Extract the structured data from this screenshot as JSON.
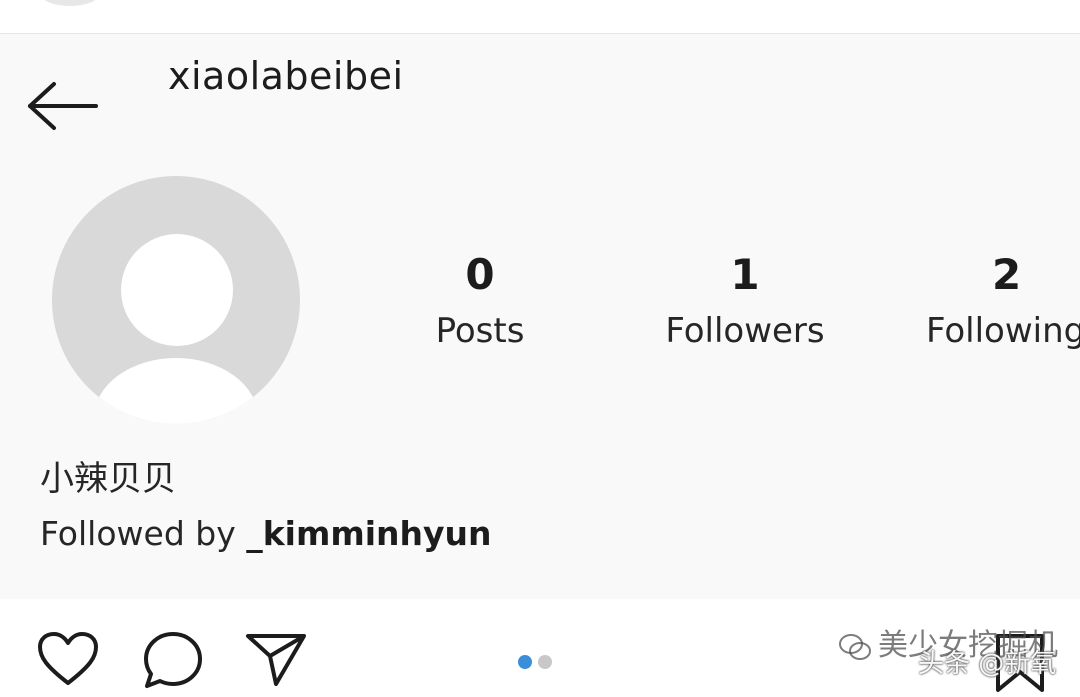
{
  "header": {
    "back_icon": "arrow-left-icon",
    "username": "xiaolabeibei"
  },
  "profile": {
    "avatar_icon": "default-avatar-icon",
    "stats": [
      {
        "value": "0",
        "label": "Posts"
      },
      {
        "value": "1",
        "label": "Followers"
      },
      {
        "value": "2",
        "label": "Following"
      }
    ],
    "display_name": "小辣贝贝",
    "followed_by_prefix": "Followed by ",
    "followed_by_handle": "_kimminhyun"
  },
  "actions": {
    "icons": [
      "heart-icon",
      "comment-icon",
      "share-icon",
      "bookmark-icon"
    ],
    "carousel_dots": 2,
    "active_dot": 0,
    "colors": {
      "active_dot": "#3b8fd9",
      "inactive_dot": "#c8c8c8"
    }
  },
  "watermark": {
    "line1": "美少女挖掘机",
    "line2": "头条 @新氧"
  }
}
